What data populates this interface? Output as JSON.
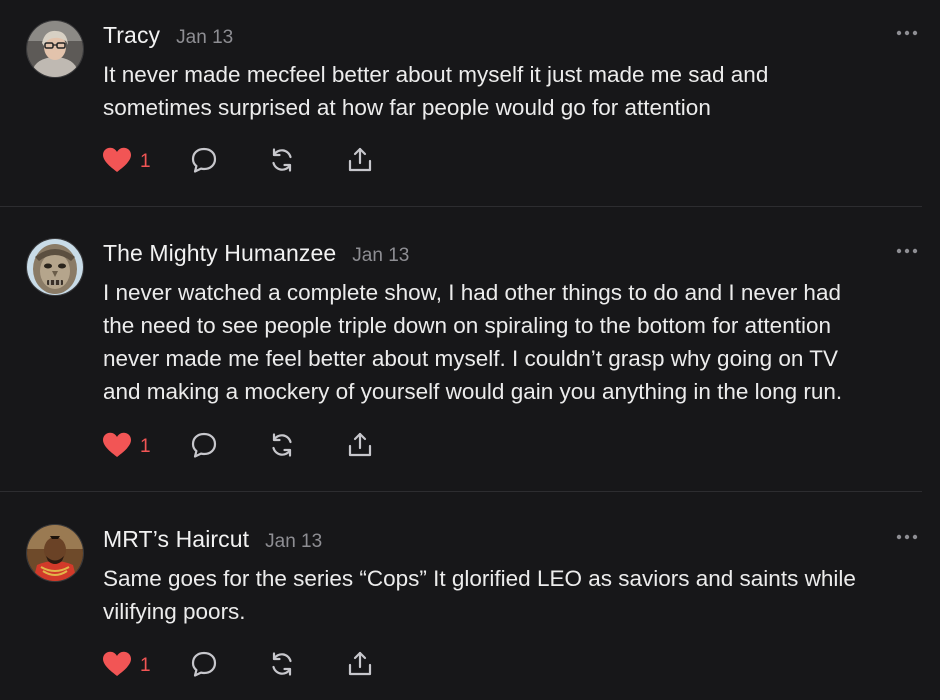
{
  "colors": {
    "background": "#171719",
    "heart": "#f25555",
    "muted": "#8e8e93",
    "icon": "#c7c7cc"
  },
  "posts": [
    {
      "author": "Tracy",
      "date": "Jan 13",
      "text_lines": [
        "It never made mecfeel better about myself it just made me sad and",
        "sometimes surprised at how far people would go for attention"
      ],
      "like_count": "1",
      "avatar": "avatar-tracy",
      "icons": [
        "heart-icon",
        "comment-icon",
        "restack-icon",
        "share-icon",
        "more-icon"
      ]
    },
    {
      "author": "The Mighty Humanzee",
      "date": "Jan 13",
      "text_lines": [
        "I never watched a complete show, I had other things to do and I never had",
        "the need to see people triple down on spiraling to the bottom for attention",
        "never made me feel better about myself. I couldn’t grasp why going on TV",
        "and making a mockery of yourself would gain you anything in the long run."
      ],
      "like_count": "1",
      "avatar": "avatar-mighty-humanzee",
      "icons": [
        "heart-icon",
        "comment-icon",
        "restack-icon",
        "share-icon",
        "more-icon"
      ]
    },
    {
      "author": "MRT’s Haircut",
      "date": "Jan 13",
      "text_lines": [
        "Same goes for the series “Cops” It glorified LEO as saviors and saints while",
        "vilifying poors."
      ],
      "like_count": "1",
      "avatar": "avatar-mrts-haircut",
      "icons": [
        "heart-icon",
        "comment-icon",
        "restack-icon",
        "share-icon",
        "more-icon"
      ]
    }
  ]
}
